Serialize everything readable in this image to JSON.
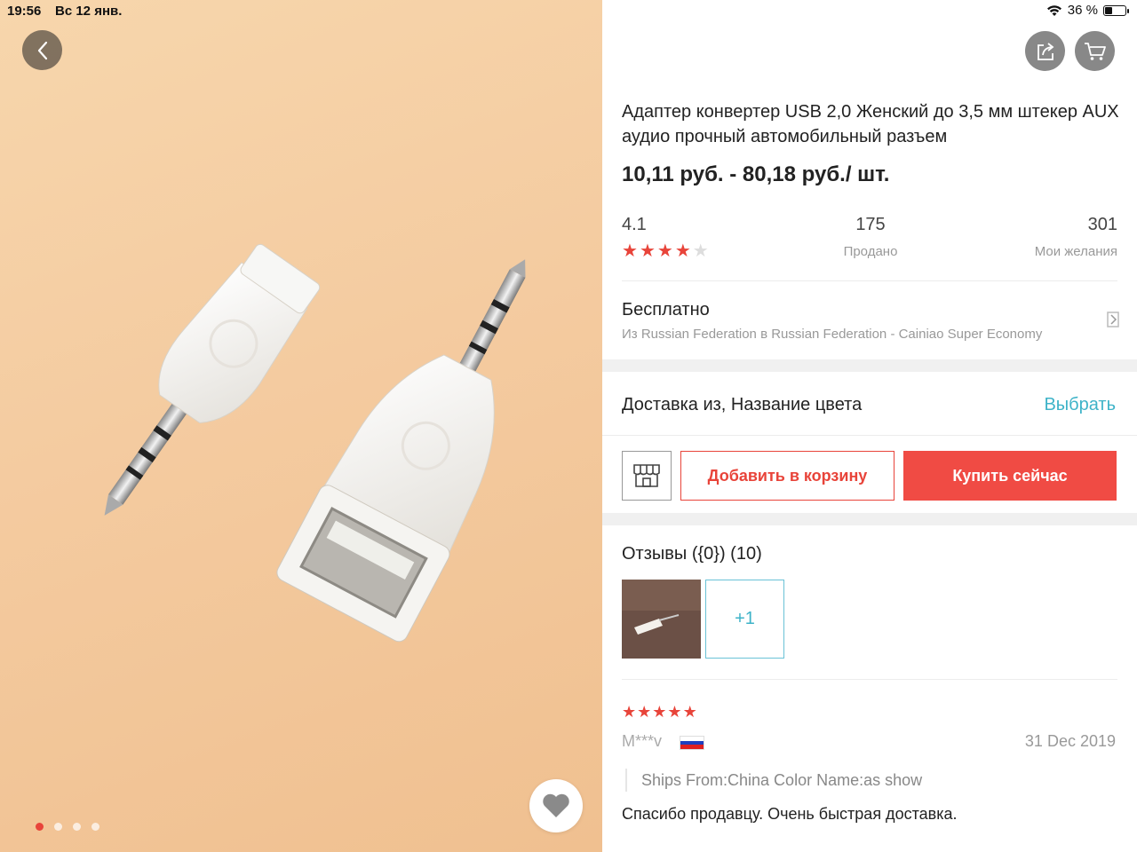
{
  "status_bar": {
    "time": "19:56",
    "date": "Вс 12 янв.",
    "battery_text": "36 %",
    "battery_level": 0.36
  },
  "gallery": {
    "icons": {
      "back": "chevron-left-icon",
      "favorite": "heart-icon"
    },
    "image_count": 4,
    "active_index": 0
  },
  "header": {
    "icons": {
      "share": "share-icon",
      "cart": "cart-icon"
    }
  },
  "product": {
    "title": "Адаптер конвертер USB 2,0 Женский до 3,5 мм штекер AUX аудио прочный автомобильный разъем",
    "price": "10,11 руб. - 80,18 руб./ шт."
  },
  "stats": {
    "rating": "4.1",
    "rating_stars": 4,
    "sold_value": "175",
    "sold_label": "Продано",
    "wishlist_value": "301",
    "wishlist_label": "Мои желания"
  },
  "shipping": {
    "title": "Бесплатно",
    "subtitle": "Из Russian Federation в Russian Federation - Cainiao Super Economy"
  },
  "variant": {
    "label": "Доставка из, Название цвета",
    "choose": "Выбрать"
  },
  "actions": {
    "store_icon": "store-icon",
    "add_to_cart": "Добавить в корзину",
    "buy_now": "Купить сейчас"
  },
  "reviews": {
    "title": "Отзывы ({0}) (10)",
    "more_photos": "+1",
    "first": {
      "stars": 5,
      "user": "M***v",
      "country_flag": "russia-flag",
      "date": "31 Dec 2019",
      "meta": "Ships From:China Color Name:as show",
      "text": "Спасибо продавцу. Очень быстрая доставка."
    }
  },
  "colors": {
    "accent_red": "#f04b44",
    "link_teal": "#3eb3c8",
    "star_red": "#e8443a"
  }
}
